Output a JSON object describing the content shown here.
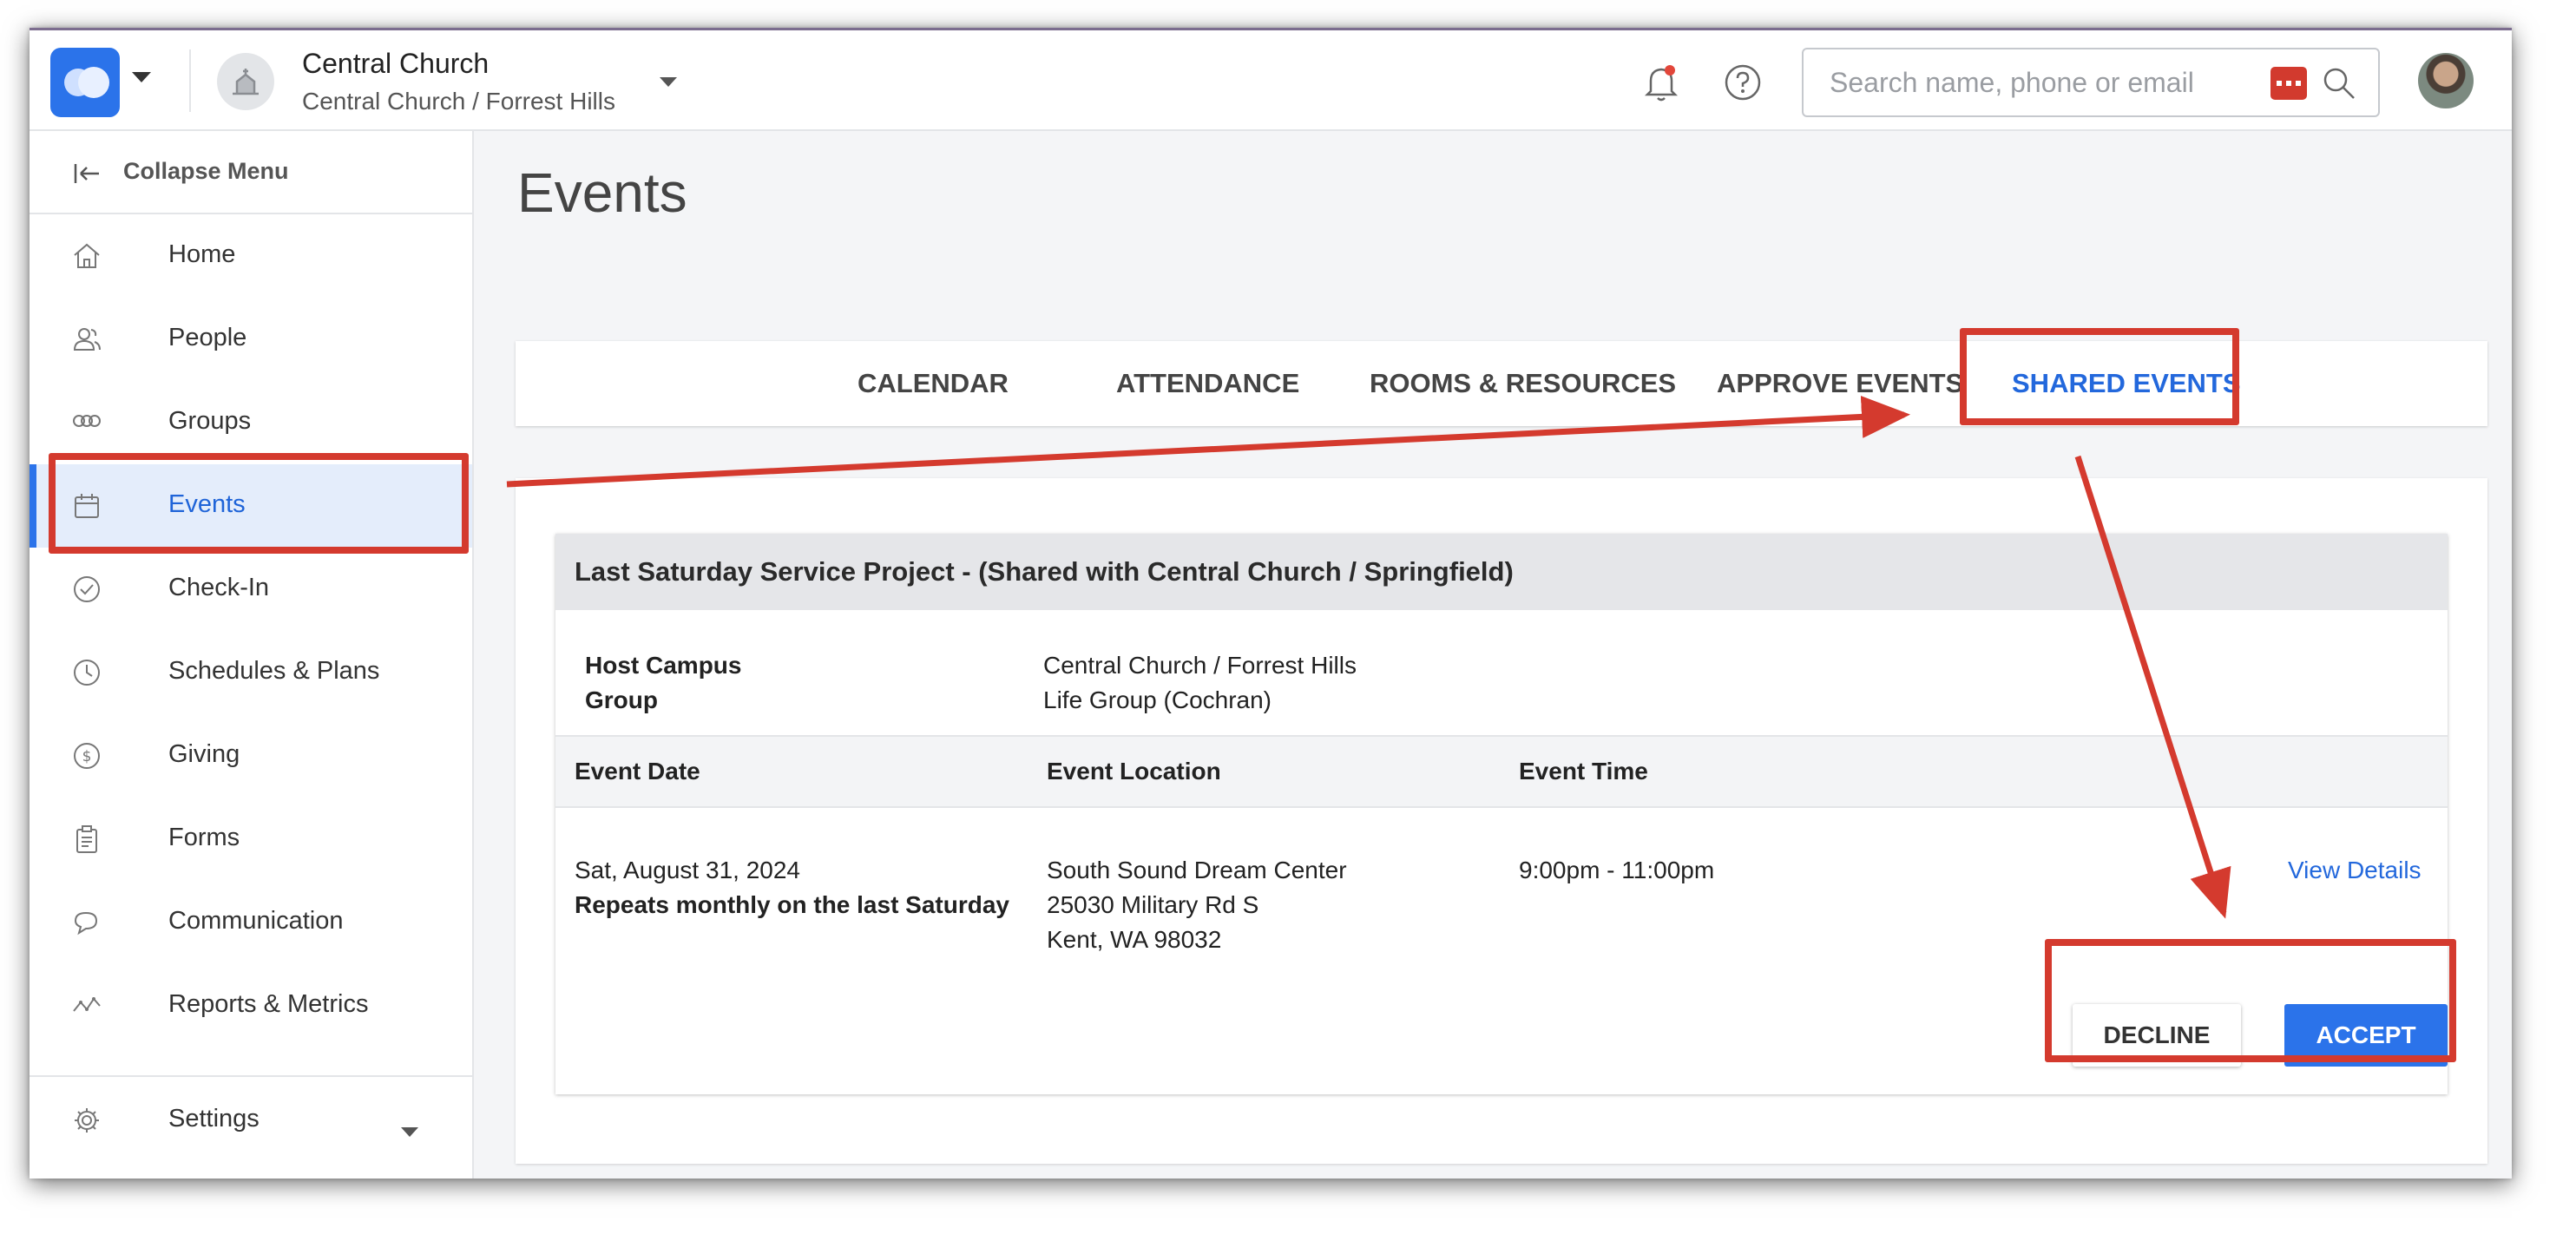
{
  "header": {
    "church_name": "Central Church",
    "campus_path": "Central Church / Forrest Hills",
    "search": {
      "placeholder": "Search name, phone or email"
    }
  },
  "sidebar": {
    "collapse_label": "Collapse Menu",
    "items": [
      {
        "label": "Home",
        "icon": "home-icon"
      },
      {
        "label": "People",
        "icon": "people-icon"
      },
      {
        "label": "Groups",
        "icon": "groups-icon"
      },
      {
        "label": "Events",
        "icon": "calendar-icon",
        "active": true
      },
      {
        "label": "Check-In",
        "icon": "check-circle-icon"
      },
      {
        "label": "Schedules & Plans",
        "icon": "clock-icon"
      },
      {
        "label": "Giving",
        "icon": "dollar-circle-icon"
      },
      {
        "label": "Forms",
        "icon": "clipboard-icon"
      },
      {
        "label": "Communication",
        "icon": "chat-bubbles-icon"
      },
      {
        "label": "Reports & Metrics",
        "icon": "line-chart-icon"
      },
      {
        "label": "Settings",
        "icon": "gear-icon"
      }
    ]
  },
  "main": {
    "title": "Events",
    "tabs": [
      {
        "label": "CALENDAR"
      },
      {
        "label": "ATTENDANCE"
      },
      {
        "label": "ROOMS & RESOURCES"
      },
      {
        "label": "APPROVE EVENTS"
      },
      {
        "label": "SHARED EVENTS",
        "active": true
      }
    ],
    "shared_event": {
      "title": "Last Saturday Service Project - (Shared with Central Church / Springfield)",
      "host_campus_label": "Host Campus",
      "host_campus_value": "Central Church / Forrest Hills",
      "group_label": "Group",
      "group_value": "Life Group (Cochran)",
      "columns": {
        "date": "Event Date",
        "location": "Event Location",
        "time": "Event Time"
      },
      "date": "Sat, August 31, 2024",
      "recurrence": "Repeats monthly on the last Saturday",
      "location_lines": [
        "South Sound Dream Center",
        "25030 Military Rd S",
        "Kent, WA 98032"
      ],
      "time": "9:00pm - 11:00pm",
      "view_details": "View Details",
      "decline_label": "DECLINE",
      "accept_label": "ACCEPT"
    }
  },
  "colors": {
    "accent_blue": "#2B73EA",
    "annotation_red": "#D43A2E",
    "active_nav_bg": "#E4EDFB"
  }
}
